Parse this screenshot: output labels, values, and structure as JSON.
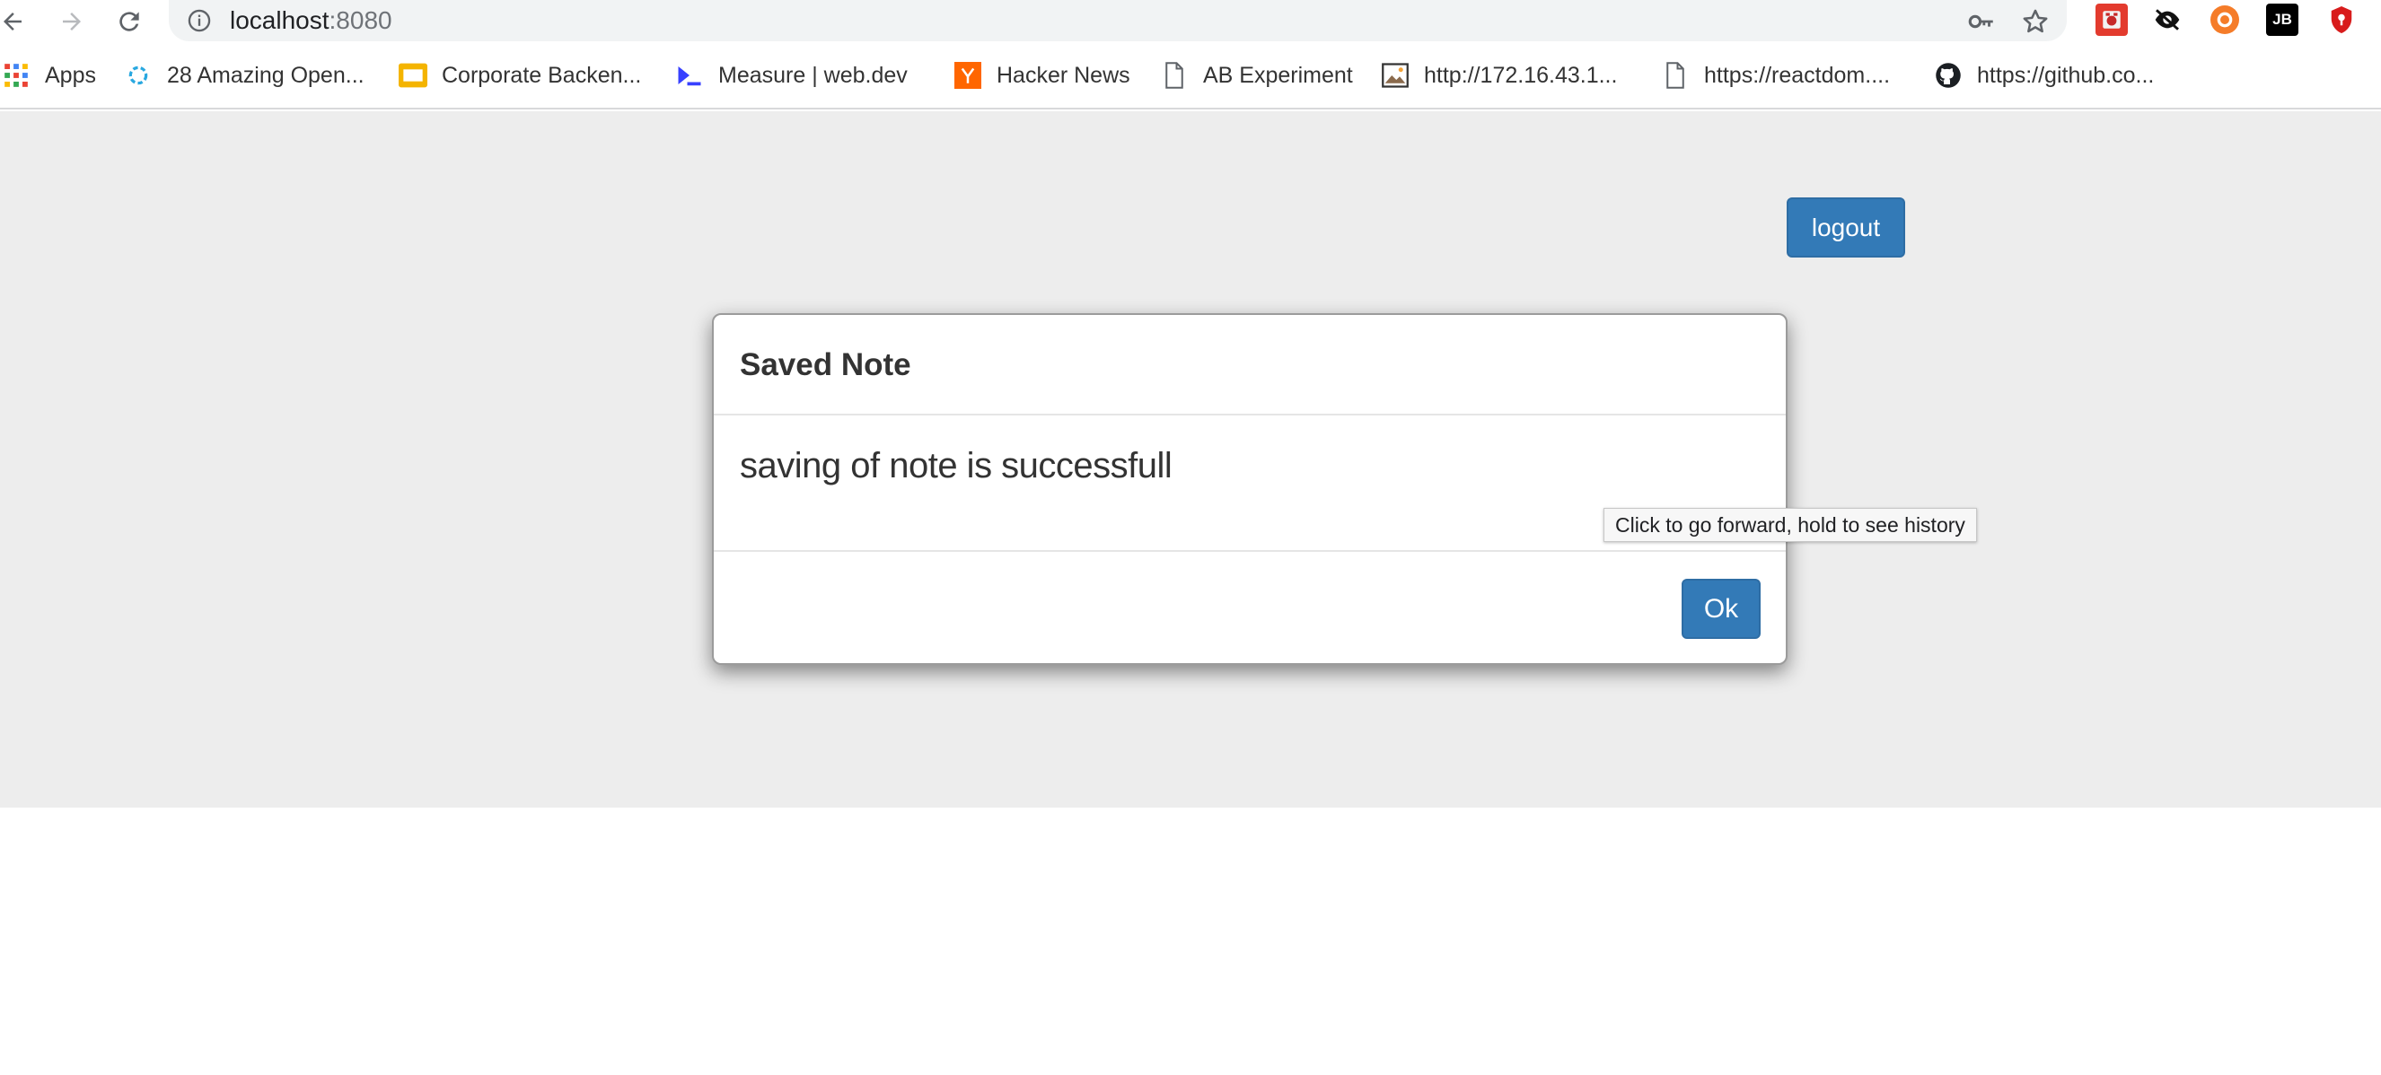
{
  "browser": {
    "url_host": "localhost",
    "url_port": ":8080",
    "tooltip": "Click to go forward, hold to see history",
    "extensions": [
      {
        "name": "ext-red",
        "color": "#e33b2e",
        "label": ""
      },
      {
        "name": "ext-dark",
        "color": "#ffffff",
        "label": ""
      },
      {
        "name": "ext-orange",
        "color": "#f57c29",
        "label": ""
      },
      {
        "name": "ext-jetbrains",
        "color": "#000000",
        "label": "JB"
      },
      {
        "name": "ext-shield",
        "color": "#d81c1c",
        "label": ""
      }
    ]
  },
  "bookmarks": [
    {
      "label": "Apps",
      "icon": "apps-grid-icon"
    },
    {
      "label": "28 Amazing Open...",
      "icon": "spinner-icon"
    },
    {
      "label": "Corporate Backen...",
      "icon": "slides-icon"
    },
    {
      "label": "Measure  |  web.dev",
      "icon": "webdev-icon"
    },
    {
      "label": "Hacker News",
      "icon": "hacker-news-icon"
    },
    {
      "label": "AB Experiment",
      "icon": "page-icon"
    },
    {
      "label": "http://172.16.43.1...",
      "icon": "image-icon"
    },
    {
      "label": "https://reactdom....",
      "icon": "page-icon"
    },
    {
      "label": "https://github.co...",
      "icon": "github-icon"
    }
  ],
  "page": {
    "logout_label": "logout",
    "modal": {
      "title": "Saved Note",
      "message": "saving of note is successfull",
      "ok_label": "Ok"
    }
  },
  "colors": {
    "primary": "#337ab7",
    "page_background": "#ededed"
  }
}
